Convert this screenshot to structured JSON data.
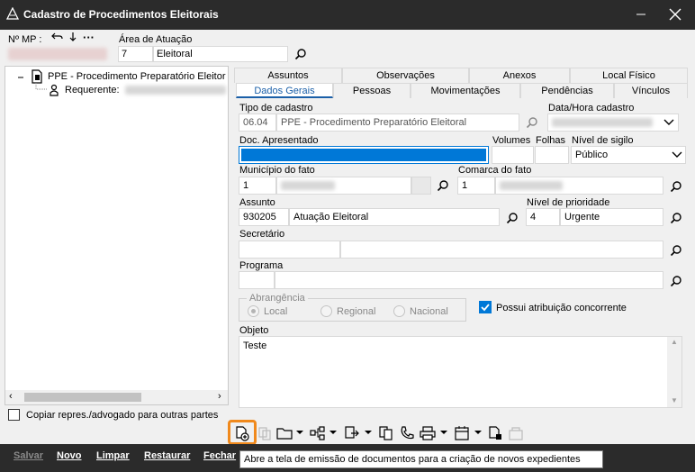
{
  "window": {
    "title": "Cadastro de Procedimentos Eleitorais"
  },
  "header": {
    "mp_label": "Nº MP :",
    "area_label": "Área de Atuação",
    "area_code": "7",
    "area_name": "Eleitoral"
  },
  "tree": {
    "root_label": "PPE - Procedimento Preparatório Eleitor",
    "child_label": "Requerente:",
    "copy_label": "Copiar repres./advogado para outras partes"
  },
  "tabs_back": [
    "Assuntos",
    "Observações",
    "Anexos",
    "Local Físico"
  ],
  "tabs_front": [
    "Dados Gerais",
    "Pessoas",
    "Movimentações",
    "Pendências",
    "Vínculos"
  ],
  "form": {
    "tipo_label": "Tipo de cadastro",
    "tipo_code": "06.04",
    "tipo_name": "PPE - Procedimento Preparatório Eleitoral",
    "data_label": "Data/Hora cadastro",
    "doc_label": "Doc. Apresentado",
    "volumes_label": "Volumes",
    "folhas_label": "Folhas",
    "sigilo_label": "Nível de sigilo",
    "sigilo_value": "Público",
    "municipio_label": "Município do fato",
    "municipio_code": "1",
    "comarca_label": "Comarca do fato",
    "comarca_code": "1",
    "assunto_label": "Assunto",
    "assunto_code": "930205",
    "assunto_name": "Atuação Eleitoral",
    "prioridade_label": "Nível de prioridade",
    "prioridade_code": "4",
    "prioridade_name": "Urgente",
    "secretario_label": "Secretário",
    "programa_label": "Programa",
    "abrangencia_label": "Abrangência",
    "radio_local": "Local",
    "radio_regional": "Regional",
    "radio_nacional": "Nacional",
    "concorrente_label": "Possui atribuição concorrente",
    "objeto_label": "Objeto",
    "objeto_value": "Teste"
  },
  "footer": {
    "salvar": "Salvar",
    "novo": "Novo",
    "limpar": "Limpar",
    "restaurar": "Restaurar",
    "fechar": "Fechar"
  },
  "tooltip": "Abre a tela de emissão de documentos para a criação de novos expedientes",
  "colors": {
    "titlebar": "#2b2b2b",
    "accent": "#0078d7",
    "tab_active": "#1a5fa8",
    "highlight": "#f0891c"
  }
}
